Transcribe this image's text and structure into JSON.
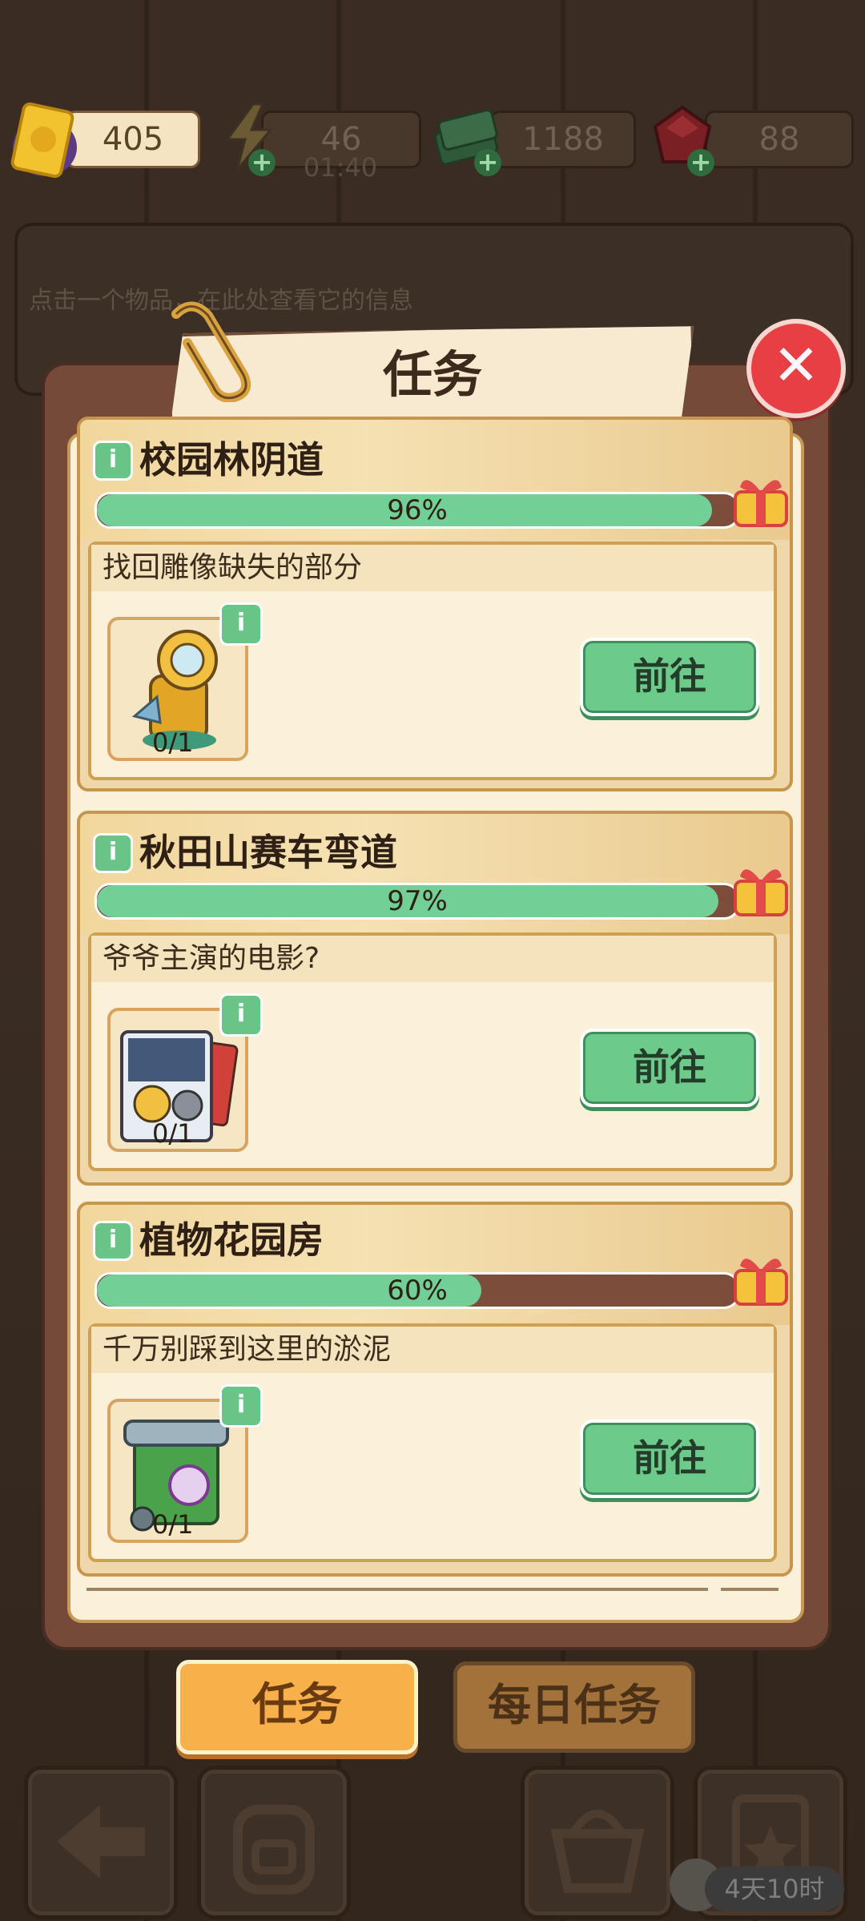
{
  "header": {
    "tickets": "405",
    "energy": "46",
    "energy_timer": "01:40",
    "cash": "1188",
    "gems": "88"
  },
  "info_panel": {
    "text": "点击一个物品，在此处查看它的信息"
  },
  "modal": {
    "title": "任务",
    "close_label": "✕"
  },
  "tasks": [
    {
      "location": "校园林阴道",
      "progress_text": "96%",
      "progress": 0.96,
      "task_title": "找回雕像缺失的部分",
      "item_icon": "statue-part-icon",
      "count": "0/1",
      "go_label": "前往"
    },
    {
      "location": "秋田山赛车弯道",
      "progress_text": "97%",
      "progress": 0.97,
      "task_title": "爷爷主演的电影?",
      "item_icon": "movie-poster-icon",
      "count": "0/1",
      "go_label": "前往"
    },
    {
      "location": "植物花园房",
      "progress_text": "60%",
      "progress": 0.6,
      "task_title": "千万别踩到这里的淤泥",
      "item_icon": "recycle-bin-icon",
      "count": "0/1",
      "go_label": "前往"
    }
  ],
  "tabs": {
    "tasks": "任务",
    "daily": "每日任务"
  },
  "bottom": {
    "timer": "4天10时"
  },
  "colors": {
    "progress_fill": "#72cf95",
    "go_button": "#6ccb8b",
    "close_button": "#e83f45",
    "active_tab": "#f7b04a"
  }
}
